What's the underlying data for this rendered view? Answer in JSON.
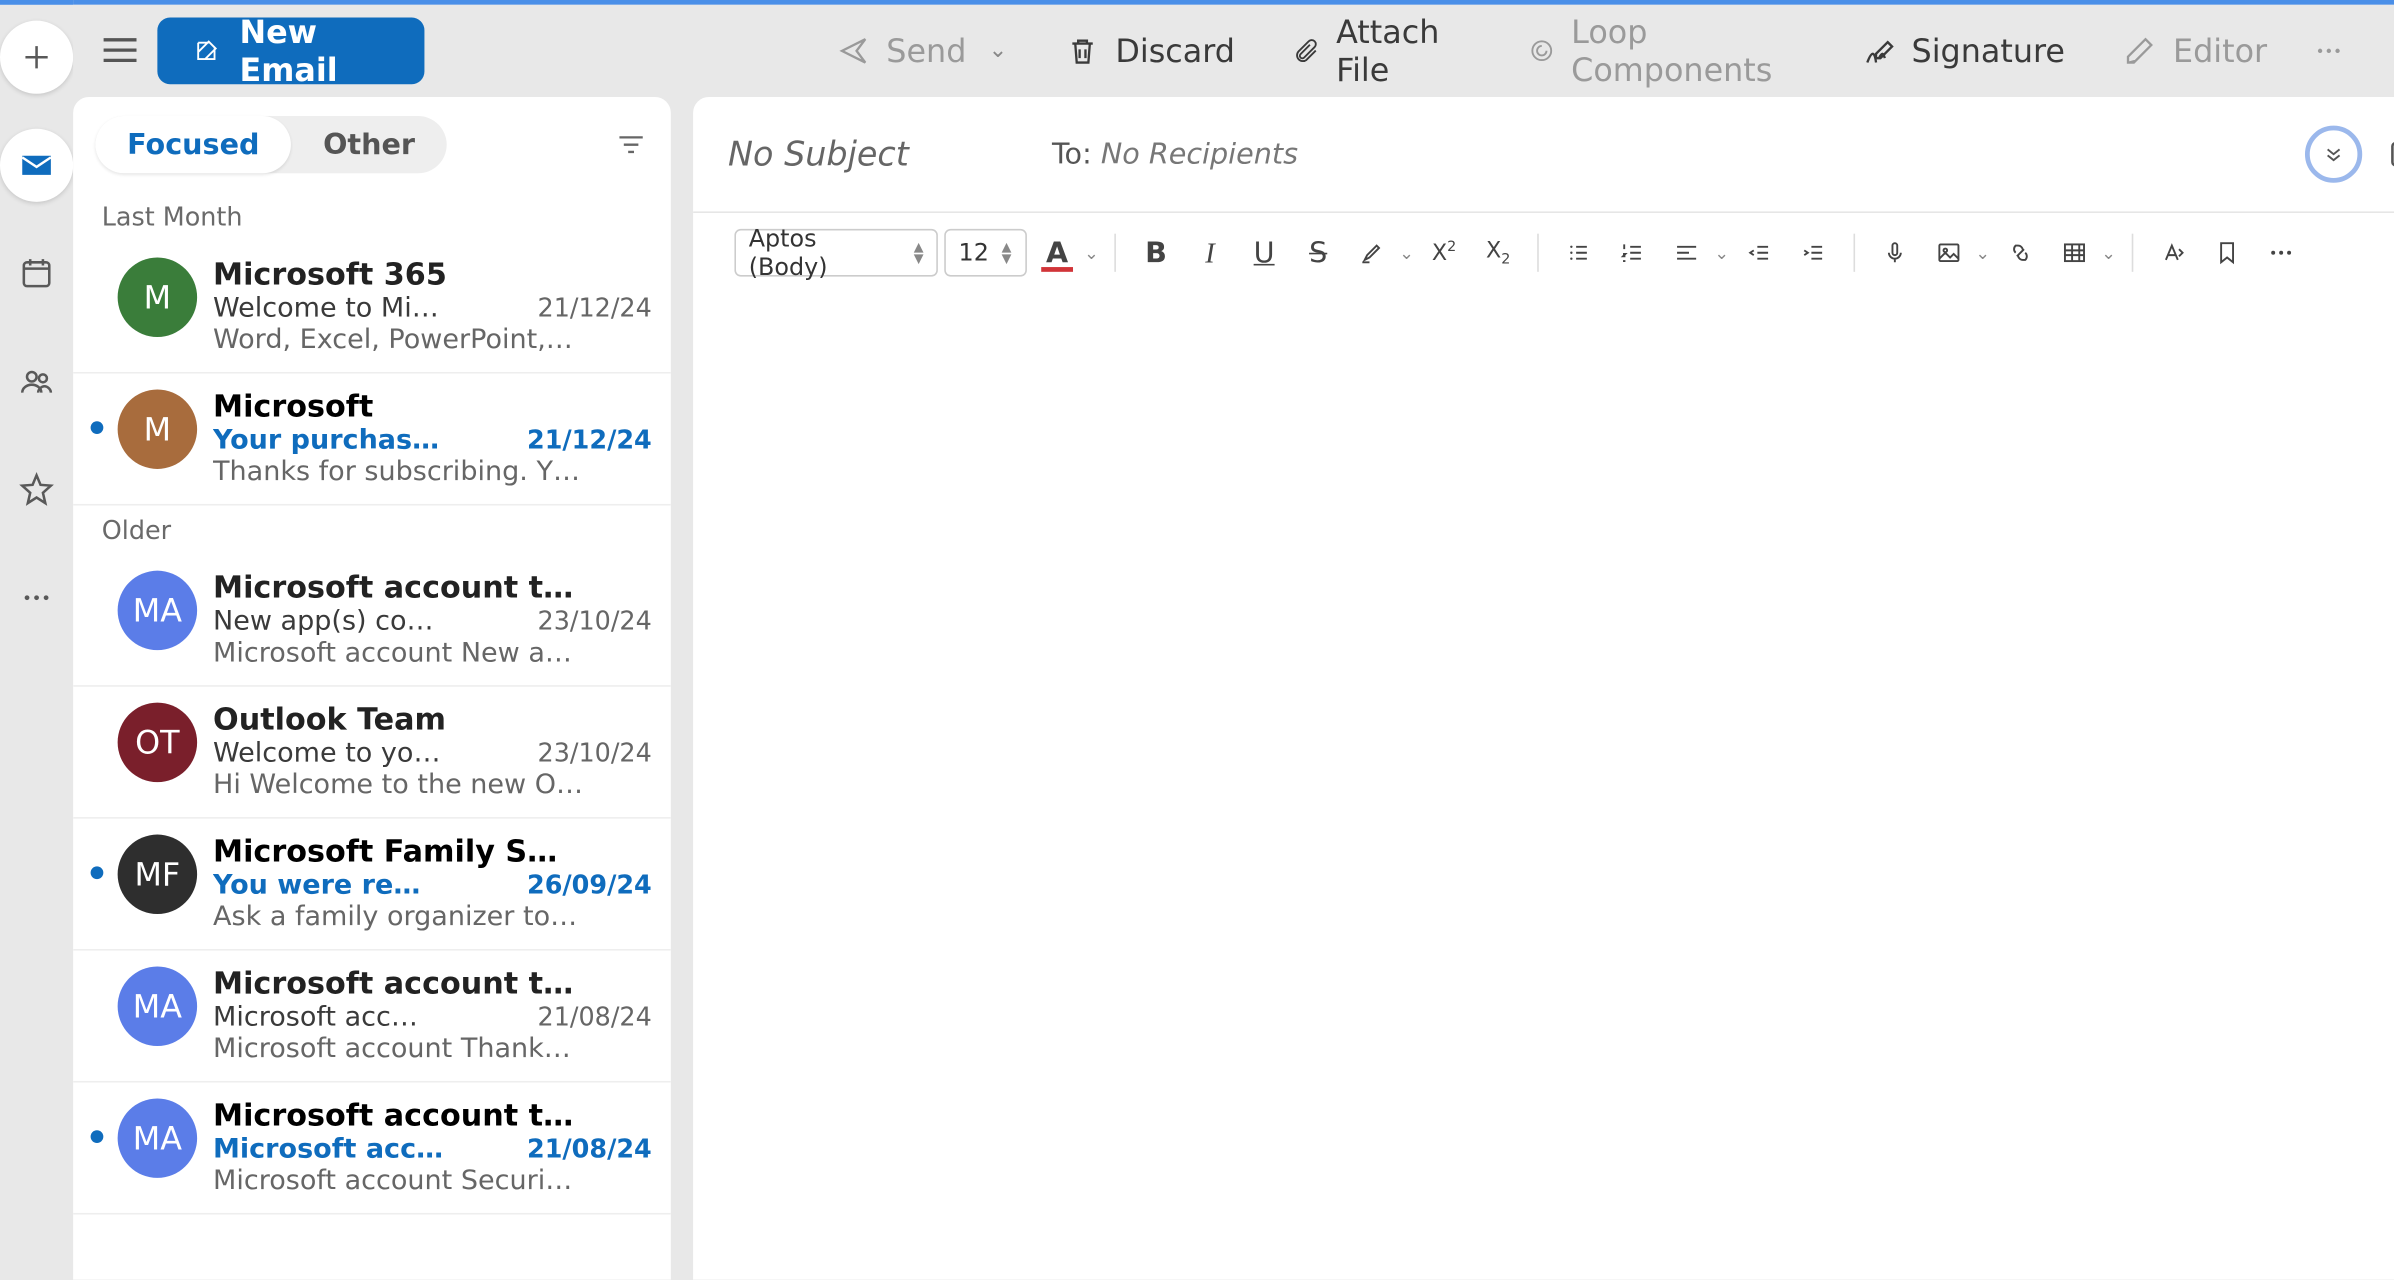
{
  "ribbon": {
    "new_email": "New Email",
    "send": "Send",
    "discard": "Discard",
    "attach": "Attach File",
    "loop": "Loop Components",
    "signature": "Signature",
    "editor": "Editor"
  },
  "tabs": {
    "focused": "Focused",
    "other": "Other"
  },
  "sections": {
    "last_month": "Last Month",
    "older": "Older"
  },
  "messages": [
    {
      "avatar": "M",
      "avatar_bg": "#3a7d3a",
      "sender": "Microsoft 365",
      "subject": "Welcome to Mi…",
      "date": "21/12/24",
      "preview": "Word, Excel, PowerPoint,…",
      "unread": false
    },
    {
      "avatar": "M",
      "avatar_bg": "#a86c3d",
      "sender": "Microsoft",
      "subject": "Your purchas…",
      "date": "21/12/24",
      "preview": "Thanks for subscribing. Y…",
      "unread": true
    },
    {
      "avatar": "MA",
      "avatar_bg": "#5b7de8",
      "sender": "Microsoft account t…",
      "subject": "New app(s) co…",
      "date": "23/10/24",
      "preview": "Microsoft account New a…",
      "unread": false
    },
    {
      "avatar": "OT",
      "avatar_bg": "#7a1f2b",
      "sender": "Outlook Team",
      "subject": "Welcome to yo…",
      "date": "23/10/24",
      "preview": "Hi Welcome to the new O…",
      "unread": false
    },
    {
      "avatar": "MF",
      "avatar_bg": "#2e2e2e",
      "sender": "Microsoft Family S…",
      "subject": "You were re…",
      "date": "26/09/24",
      "preview": "Ask a family organizer to…",
      "unread": true
    },
    {
      "avatar": "MA",
      "avatar_bg": "#5b7de8",
      "sender": "Microsoft account t…",
      "subject": "Microsoft acc…",
      "date": "21/08/24",
      "preview": "Microsoft account Thank…",
      "unread": false
    },
    {
      "avatar": "MA",
      "avatar_bg": "#5b7de8",
      "sender": "Microsoft account t…",
      "subject": "Microsoft acc…",
      "date": "21/08/24",
      "preview": "Microsoft account Securi…",
      "unread": true
    }
  ],
  "compose": {
    "subject_placeholder": "No Subject",
    "to_label": "To:",
    "to_placeholder": "No Recipients",
    "font_name": "Aptos (Body)",
    "font_size": "12"
  }
}
